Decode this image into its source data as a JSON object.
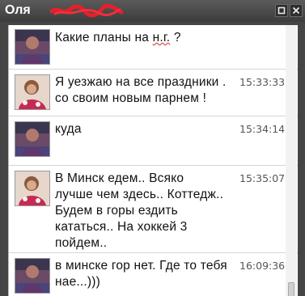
{
  "window": {
    "title": "Оля"
  },
  "messages": [
    {
      "text_before": "Какие планы на ",
      "text_marked": "н.г.",
      "text_after": " ?",
      "time": ""
    },
    {
      "text": "Я уезжаю на все праздники .\nсо своим новым парнем !",
      "time": "15:33:33"
    },
    {
      "text": "куда",
      "time": "15:34:14"
    },
    {
      "text": "В Минск  едем.. Всяко\nлучше чем здесь.. Коттедж..\nБудем в горы ездить\nкататься.. На хоккей 3\nпойдем..",
      "time": "15:35:07"
    },
    {
      "text": "в минске гор нет. Где то тебя\nнае...)))",
      "time": "16:09:36"
    }
  ],
  "icons": {
    "restore": "restore-icon",
    "close": "close-icon"
  },
  "colors": {
    "titlebar": "#454545",
    "redaction": "#e5202a",
    "message_bg": "#ffffff"
  }
}
